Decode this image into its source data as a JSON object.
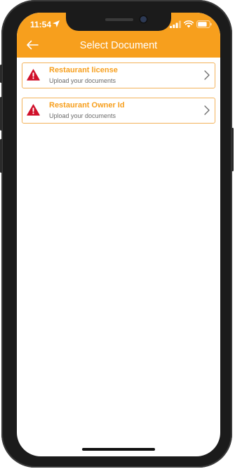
{
  "status_bar": {
    "time": "11:54"
  },
  "header": {
    "title": "Select Document",
    "back_icon": "arrow-left-icon",
    "background": "#f79f1d"
  },
  "documents": [
    {
      "name": "Restaurant license",
      "subtitle": "Upload your documents",
      "status_icon": "warning-icon",
      "status_color": "#d0102a"
    },
    {
      "name": "Restaurant Owner Id",
      "subtitle": "Upload your documents",
      "status_icon": "warning-icon",
      "status_color": "#d0102a"
    }
  ],
  "colors": {
    "accent": "#f79f1d",
    "border": "#f3b25a",
    "warning": "#d0102a"
  }
}
